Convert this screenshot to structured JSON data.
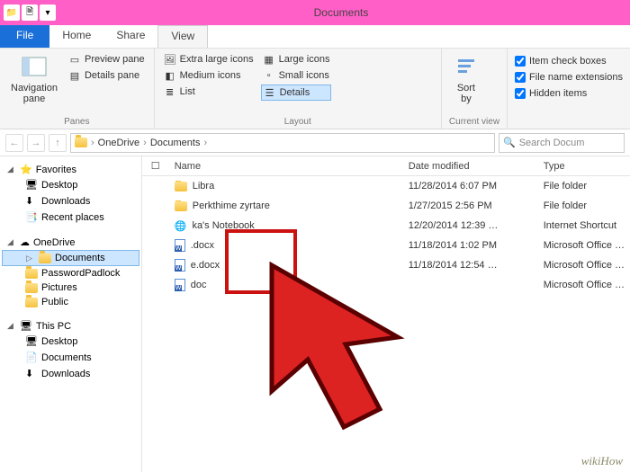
{
  "window": {
    "title": "Documents"
  },
  "tabs": {
    "file": "File",
    "home": "Home",
    "share": "Share",
    "view": "View"
  },
  "ribbon": {
    "panes": {
      "nav_pane": "Navigation\npane",
      "preview": "Preview pane",
      "details": "Details pane",
      "label": "Panes"
    },
    "layout": {
      "xl": "Extra large icons",
      "lg": "Large icons",
      "md": "Medium icons",
      "sm": "Small icons",
      "list": "List",
      "details": "Details",
      "label": "Layout"
    },
    "current": {
      "sort": "Sort\nby",
      "label": "Current view"
    },
    "showhide": {
      "item_check": "Item check boxes",
      "file_ext": "File name extensions",
      "hidden": "Hidden items"
    }
  },
  "breadcrumb": [
    "OneDrive",
    "Documents"
  ],
  "search_placeholder": "Search Docum",
  "nav": {
    "favorites": "Favorites",
    "desktop": "Desktop",
    "downloads": "Downloads",
    "recent": "Recent places",
    "onedrive": "OneDrive",
    "documents": "Documents",
    "password": "PasswordPadlock",
    "pictures": "Pictures",
    "public": "Public",
    "thispc": "This PC",
    "pc_desktop": "Desktop",
    "pc_documents": "Documents",
    "pc_downloads": "Downloads"
  },
  "columns": {
    "name": "Name",
    "date": "Date modified",
    "type": "Type"
  },
  "files": [
    {
      "name": "Libra",
      "date": "11/28/2014 6:07 PM",
      "type": "File folder",
      "icon": "folder"
    },
    {
      "name": "Perkthime zyrtare",
      "date": "1/27/2015 2:56 PM",
      "type": "File folder",
      "icon": "folder"
    },
    {
      "name": "ka's Notebook",
      "date": "12/20/2014 12:39 …",
      "type": "Internet Shortcut",
      "icon": "link"
    },
    {
      "name": ".docx",
      "date": "11/18/2014 1:02 PM",
      "type": "Microsoft Office …",
      "icon": "doc"
    },
    {
      "name": "e.docx",
      "date": "11/18/2014 12:54 …",
      "type": "Microsoft Office …",
      "icon": "doc"
    },
    {
      "name": "doc",
      "date": "",
      "type": "Microsoft Office …",
      "icon": "doc"
    }
  ],
  "watermark": "wikiHow"
}
